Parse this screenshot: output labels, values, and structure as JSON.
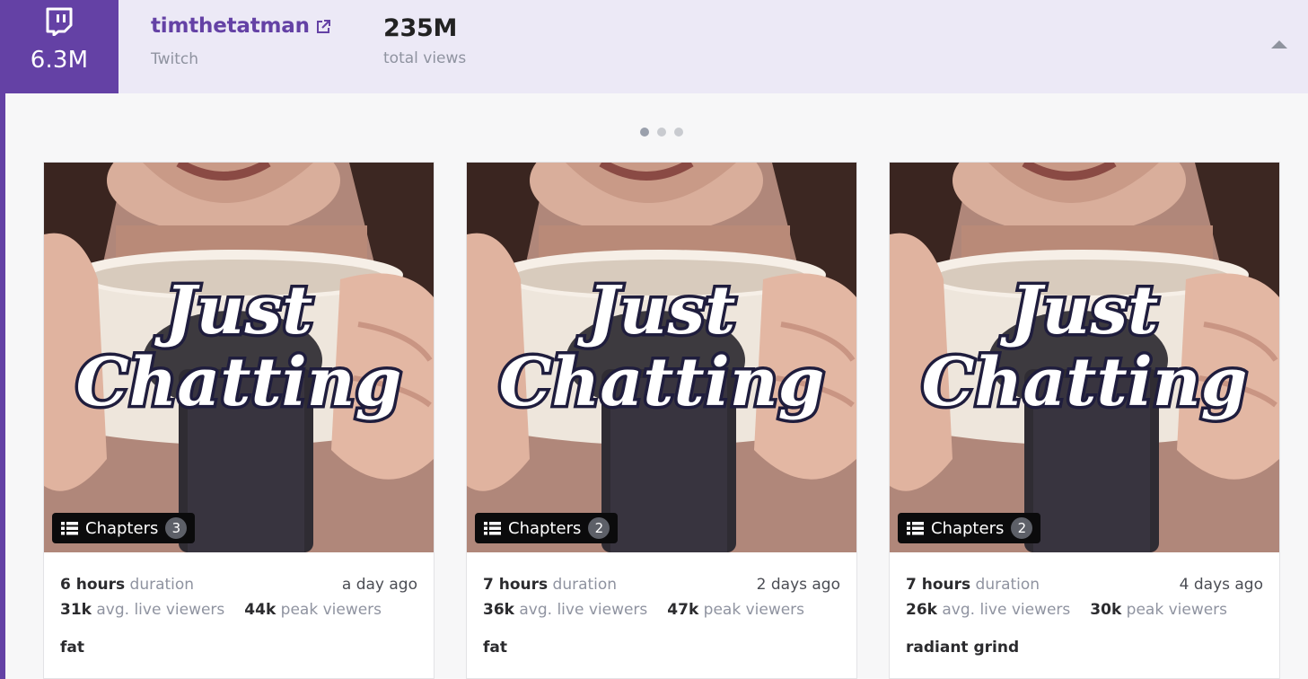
{
  "channel": {
    "rank_value": "6.3M",
    "name": "timthetatman",
    "platform": "Twitch",
    "total_views_value": "235M",
    "total_views_label": "total views",
    "icons": {
      "platform_icon": "twitch-icon",
      "external_link_icon": "external-link-icon",
      "collapse_icon": "caret-up-icon"
    },
    "brand_color": "#6441a5"
  },
  "carousel": {
    "page_count": 3,
    "active_page": 1
  },
  "streams": [
    {
      "thumbnail_alt": "Just Chatting",
      "chapters_label": "Chapters",
      "chapters_count": "3",
      "duration_value": "6 hours",
      "duration_label": "duration",
      "date": "a day ago",
      "avg_viewers_value": "31k",
      "avg_viewers_label": "avg. live viewers",
      "peak_viewers_value": "44k",
      "peak_viewers_label": "peak viewers",
      "title": "fat"
    },
    {
      "thumbnail_alt": "Just Chatting",
      "chapters_label": "Chapters",
      "chapters_count": "2",
      "duration_value": "7 hours",
      "duration_label": "duration",
      "date": "2 days ago",
      "avg_viewers_value": "36k",
      "avg_viewers_label": "avg. live viewers",
      "peak_viewers_value": "47k",
      "peak_viewers_label": "peak viewers",
      "title": "fat"
    },
    {
      "thumbnail_alt": "Just Chatting",
      "chapters_label": "Chapters",
      "chapters_count": "2",
      "duration_value": "7 hours",
      "duration_label": "duration",
      "date": "4 days ago",
      "avg_viewers_value": "26k",
      "avg_viewers_label": "avg. live viewers",
      "peak_viewers_value": "30k",
      "peak_viewers_label": "peak viewers",
      "title": "radiant grind"
    }
  ]
}
